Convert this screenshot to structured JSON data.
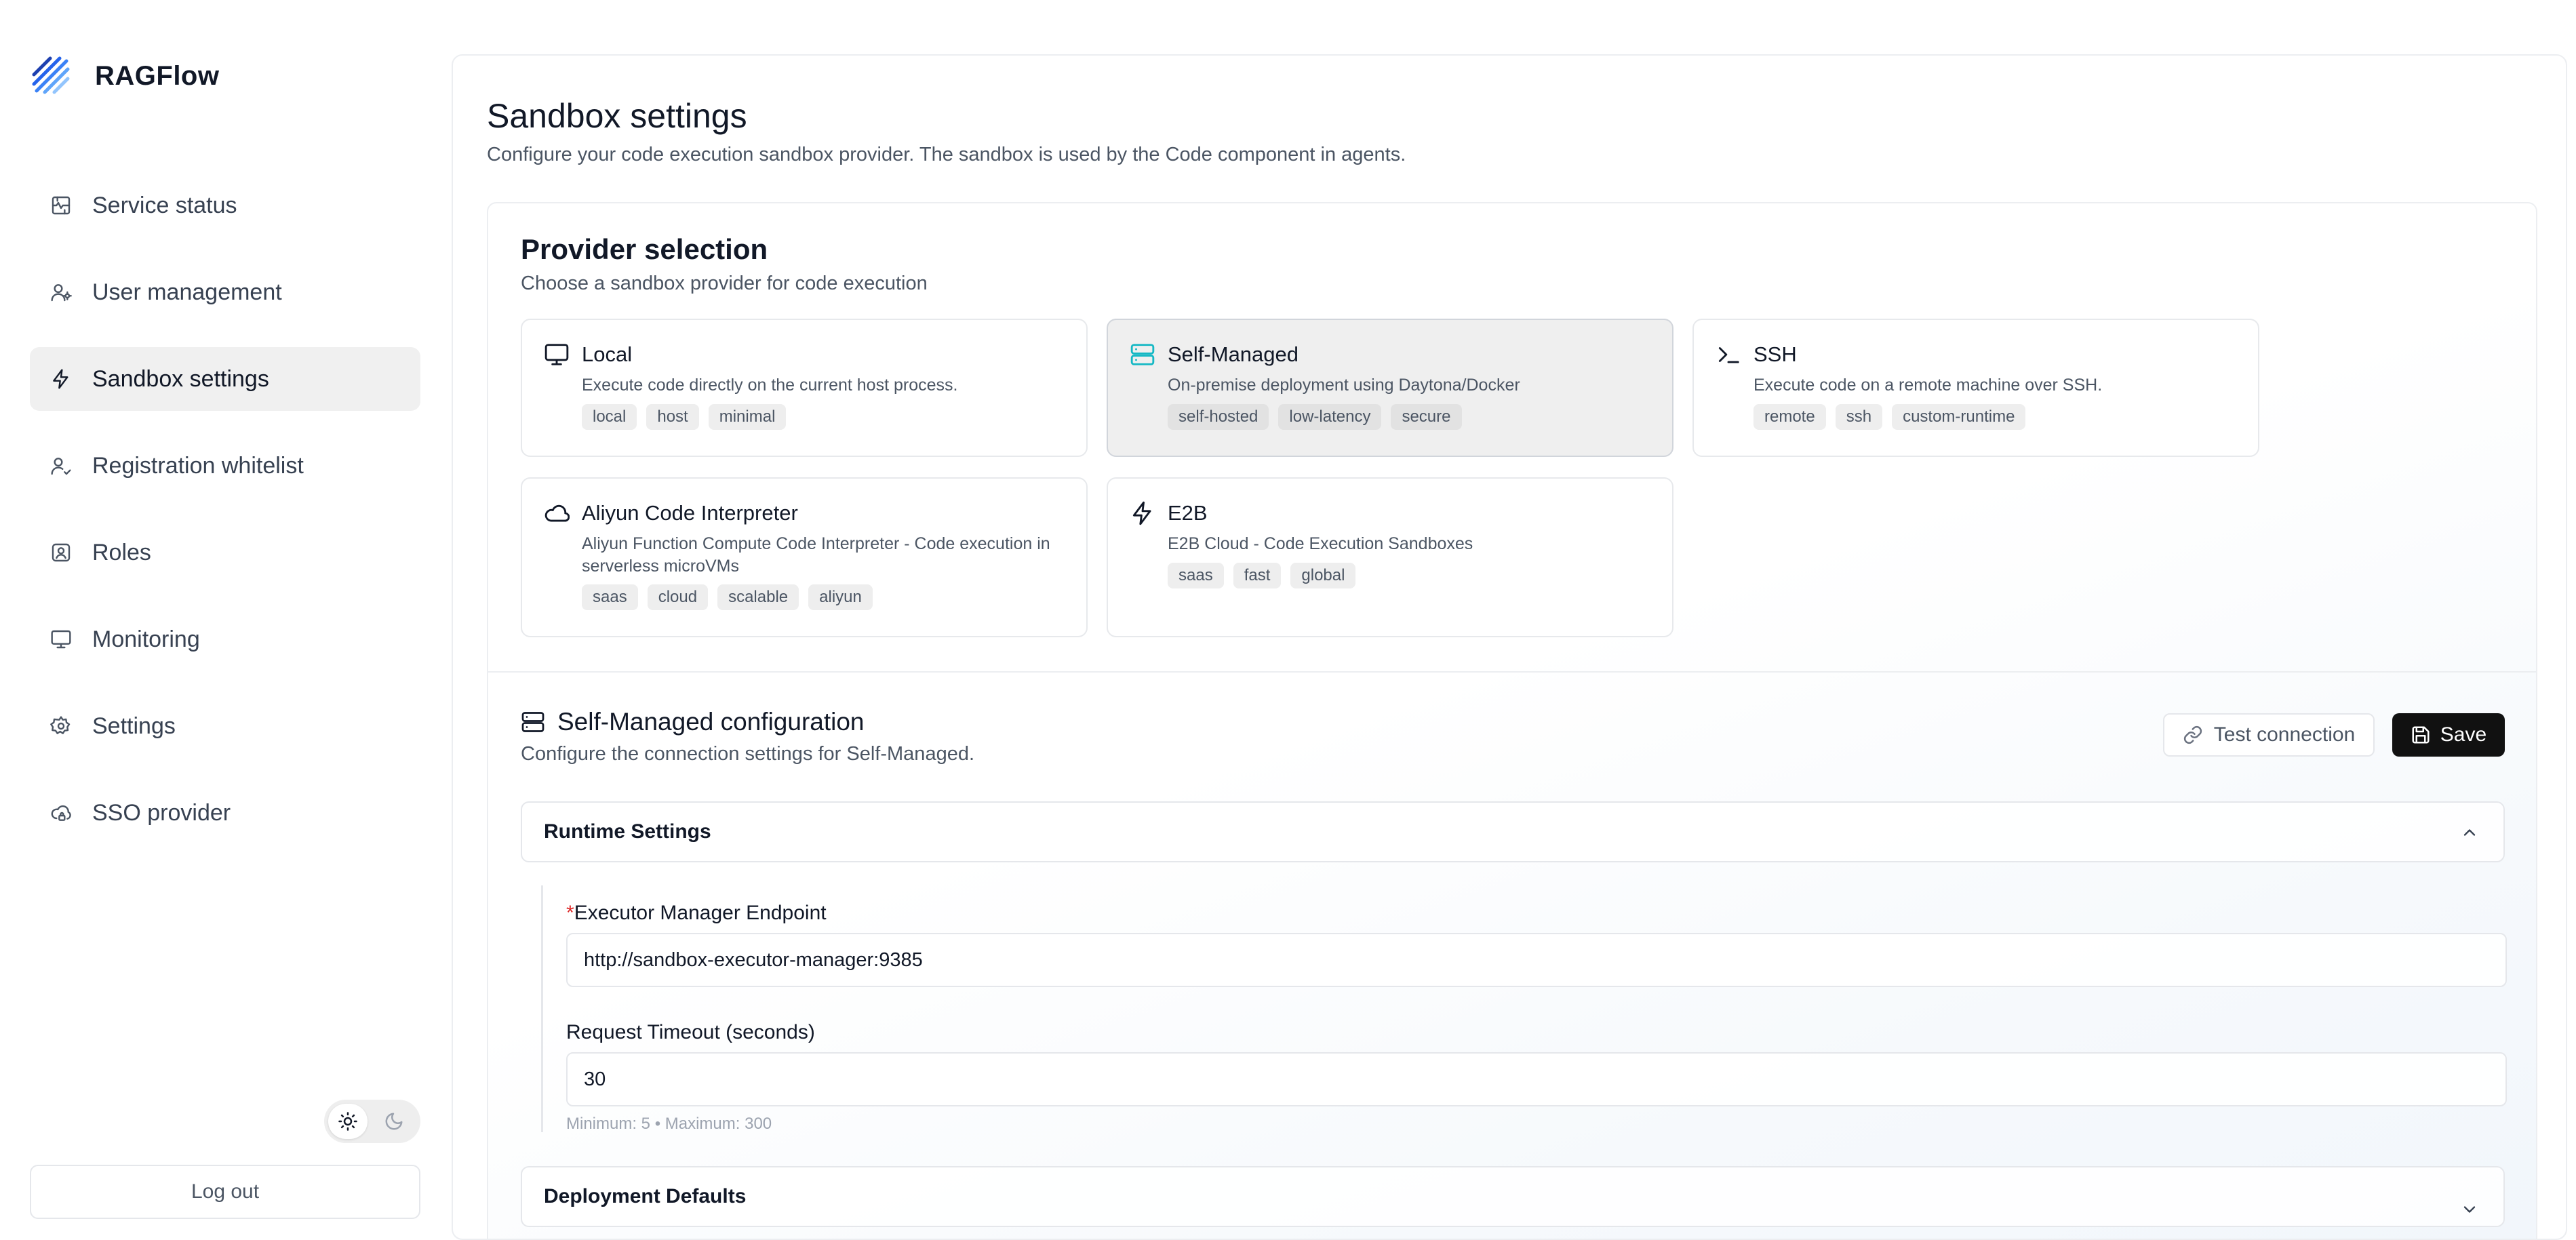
{
  "app": {
    "name": "RAGFlow"
  },
  "sidebar": {
    "items": [
      {
        "label": "Service status",
        "icon": "service-status-icon",
        "active": false
      },
      {
        "label": "User management",
        "icon": "user-management-icon",
        "active": false
      },
      {
        "label": "Sandbox settings",
        "icon": "zap-icon",
        "active": true
      },
      {
        "label": "Registration whitelist",
        "icon": "user-check-icon",
        "active": false
      },
      {
        "label": "Roles",
        "icon": "roles-icon",
        "active": false
      },
      {
        "label": "Monitoring",
        "icon": "monitor-icon",
        "active": false
      },
      {
        "label": "Settings",
        "icon": "gear-icon",
        "active": false
      },
      {
        "label": "SSO provider",
        "icon": "cloud-lock-icon",
        "active": false
      }
    ],
    "theme": {
      "selected": "light"
    },
    "logout_label": "Log out"
  },
  "page": {
    "title": "Sandbox settings",
    "subtitle": "Configure your code execution sandbox provider. The sandbox is used by the Code component in agents."
  },
  "provider_selection": {
    "title": "Provider selection",
    "subtitle": "Choose a sandbox provider for code execution",
    "selected": "Self-Managed",
    "providers": [
      {
        "name": "Local",
        "icon": "monitor-icon",
        "description": "Execute code directly on the current host process.",
        "tags": [
          "local",
          "host",
          "minimal"
        ]
      },
      {
        "name": "Self-Managed",
        "icon": "server-icon",
        "description": "On-premise deployment using Daytona/Docker",
        "tags": [
          "self-hosted",
          "low-latency",
          "secure"
        ]
      },
      {
        "name": "SSH",
        "icon": "terminal-icon",
        "description": "Execute code on a remote machine over SSH.",
        "tags": [
          "remote",
          "ssh",
          "custom-runtime"
        ]
      },
      {
        "name": "Aliyun Code Interpreter",
        "icon": "cloud-icon",
        "description": "Aliyun Function Compute Code Interpreter - Code execution in serverless microVMs",
        "tags": [
          "saas",
          "cloud",
          "scalable",
          "aliyun"
        ]
      },
      {
        "name": "E2B",
        "icon": "zap-icon",
        "description": "E2B Cloud - Code Execution Sandboxes",
        "tags": [
          "saas",
          "fast",
          "global"
        ]
      }
    ]
  },
  "config": {
    "title": "Self-Managed configuration",
    "subtitle": "Configure the connection settings for Self-Managed.",
    "test_label": "Test connection",
    "save_label": "Save",
    "runtime": {
      "title": "Runtime Settings",
      "expanded": true,
      "endpoint_label": "Executor Manager Endpoint",
      "endpoint_required_mark": "*",
      "endpoint_value": "http://sandbox-executor-manager:9385",
      "timeout_label": "Request Timeout (seconds)",
      "timeout_value": "30",
      "timeout_hint": "Minimum: 5 • Maximum: 300"
    },
    "deployment": {
      "title": "Deployment Defaults",
      "expanded": false
    }
  }
}
